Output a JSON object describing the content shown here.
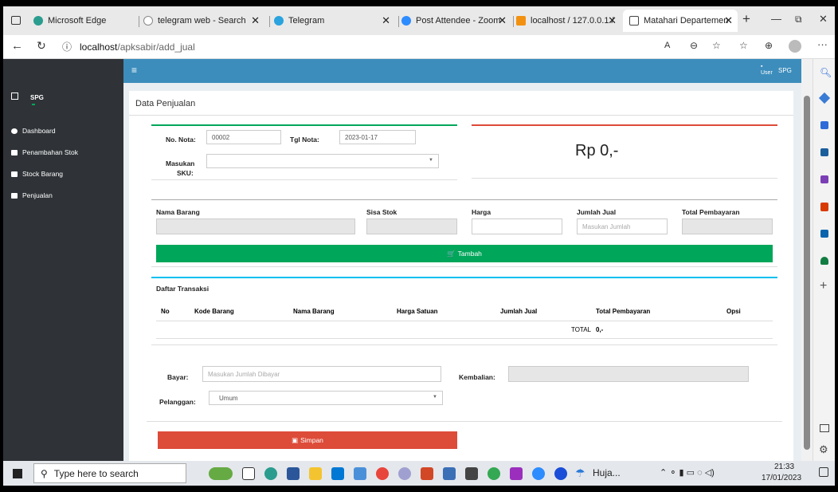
{
  "tabs": [
    {
      "label": "Microsoft Edge"
    },
    {
      "label": "telegram web - Search"
    },
    {
      "label": "Telegram"
    },
    {
      "label": "Post Attendee - Zoom"
    },
    {
      "label": "localhost / 127.0.0.1 /"
    },
    {
      "label": "Matahari Departemen"
    }
  ],
  "address": {
    "host": "localhost",
    "path": "/apksabir/add_jual"
  },
  "sidebar": {
    "user": "SPG",
    "items": [
      {
        "label": "Dashboard"
      },
      {
        "label": "Penambahan Stok"
      },
      {
        "label": "Stock Barang"
      },
      {
        "label": "Penjualan"
      }
    ]
  },
  "topnav": {
    "user_img": "User",
    "user_name": "SPG"
  },
  "page": {
    "title": "Data Penjualan"
  },
  "form": {
    "no_nota_label": "No. Nota:",
    "no_nota_value": "00002",
    "tgl_nota_label": "Tgl Nota:",
    "tgl_nota_value": "2023-01-17",
    "sku_label_1": "Masukan",
    "sku_label_2": "SKU:",
    "total_display": "Rp 0,-",
    "nama_barang_label": "Nama Barang",
    "sisa_stok_label": "Sisa Stok",
    "harga_label": "Harga",
    "jumlah_jual_label": "Jumlah Jual",
    "jumlah_jual_placeholder": "Masukan Jumlah",
    "total_pembayaran_label": "Total Pembayaran",
    "tambah_button": "Tambah"
  },
  "transactions": {
    "title": "Daftar Transaksi",
    "columns": [
      "No",
      "Kode Barang",
      "Nama Barang",
      "Harga Satuan",
      "Jumlah Jual",
      "Total Pembayaran",
      "Opsi"
    ],
    "total_label": "TOTAL",
    "total_value": "0,-"
  },
  "payment": {
    "bayar_label": "Bayar:",
    "bayar_placeholder": "Masukan Jumlah Dibayar",
    "kembalian_label": "Kembalian:",
    "pelanggan_label": "Pelanggan:",
    "pelanggan_value": "Umum",
    "simpan_button": "Simpan"
  },
  "taskbar": {
    "search_placeholder": "Type here to search",
    "weather": "Huja...",
    "time": "21:33",
    "date": "17/01/2023"
  },
  "colors": {
    "green": "#00a65a",
    "red": "#dd4b39",
    "blue": "#3c8dbc",
    "sidebar": "#2f3337"
  }
}
